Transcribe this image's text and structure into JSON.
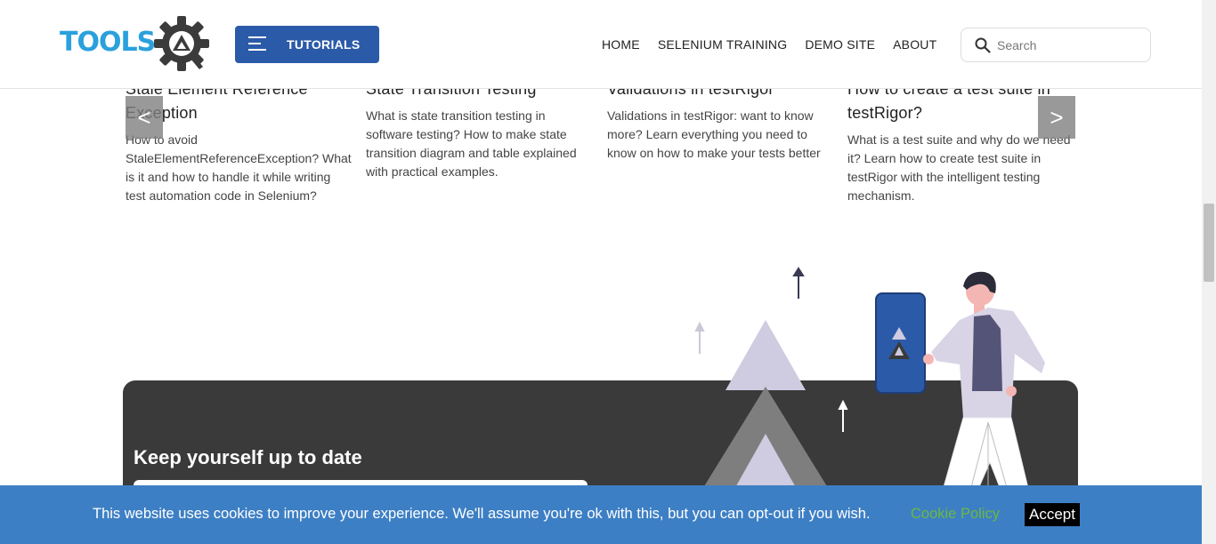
{
  "header": {
    "logo_text": "TOOLS",
    "logo_badge_letter": "A",
    "tutorials_label": "TUTORIALS",
    "nav": [
      {
        "label": "HOME"
      },
      {
        "label": "SELENIUM TRAINING"
      },
      {
        "label": "DEMO SITE"
      },
      {
        "label": "ABOUT"
      }
    ],
    "search_placeholder": "Search"
  },
  "carousel": {
    "prev_label": "<",
    "next_label": ">",
    "cards": [
      {
        "title": "Stale Element Reference Exception",
        "description": "How to avoid StaleElementReferenceException? What is it and how to handle it while writing test automation code in Selenium?"
      },
      {
        "title": "State Transition Testing",
        "description": "What is state transition testing in software testing? How to make state transition diagram and table explained with practical examples."
      },
      {
        "title": "Validations in testRigor",
        "description": "Validations in testRigor: want to know more? Learn everything you need to know on how to make your tests better"
      },
      {
        "title": "How to create a test suite in testRigor?",
        "description": "What is a test suite and why do we need it? Learn how to create test suite in testRigor with the intelligent testing mechanism."
      }
    ]
  },
  "newsletter": {
    "heading": "Keep yourself up to date"
  },
  "cookie": {
    "text": "This website uses cookies to improve your experience. We'll assume you're ok with this, but you can opt-out if you wish.",
    "policy_link": "Cookie Policy",
    "accept_label": "Accept"
  },
  "colors": {
    "brand_blue": "#2b5ba8",
    "logo_blue": "#2aa1dc",
    "cookie_bar": "#3d7fc4",
    "cookie_link": "#6cb843",
    "newsletter_bg": "#3a3a3a"
  }
}
